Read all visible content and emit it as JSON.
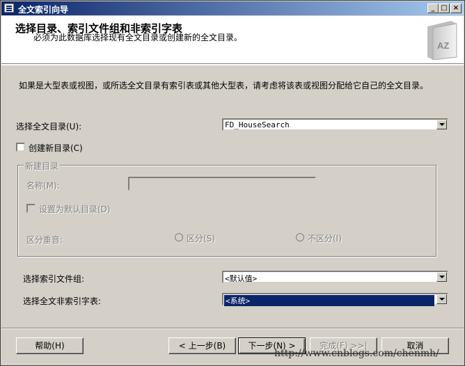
{
  "window": {
    "title": "全文索引向导"
  },
  "header": {
    "title": "选择目录、索引文件组和非索引字表",
    "subtitle": "必须为此数据库选择现有全文目录或创建新的全文目录。",
    "book_label": "AZ"
  },
  "body": {
    "instruction": "如果是大型表或视图，或所选全文目录有索引表或其他大型表，请考虑将该表或视图分配给它自己的全文目录。",
    "catalog": {
      "label": "选择全文目录(U):",
      "value": "FD_HouseSearch"
    },
    "create_new": {
      "label": "创建新目录(C)",
      "checked": false
    },
    "new_catalog": {
      "group_title": "新建目录",
      "name_label": "名称(M):",
      "name_value": "",
      "default_label": "设置为默认目录(D)",
      "accent_label": "区分重音:",
      "accent_sensitive": "区分(S)",
      "accent_insensitive": "不区分(I)"
    },
    "filegroup": {
      "label": "选择索引文件组:",
      "value": "<默认值>"
    },
    "stoplist": {
      "label": "选择全文非索引字表:",
      "value": "<系统>"
    }
  },
  "footer": {
    "help": "帮助(H)",
    "back": "< 上一步(B)",
    "next": "下一步(N) >",
    "finish": "完成(F) >>|",
    "cancel": "取消"
  },
  "watermark": "http://www.cnblogs.com/chenmh/"
}
